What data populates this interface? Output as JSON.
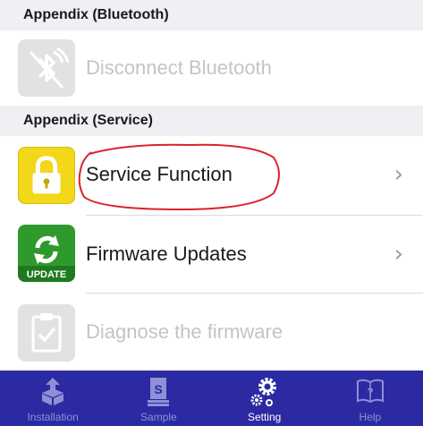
{
  "sections": {
    "bluetooth_header": "Appendix (Bluetooth)",
    "service_header": "Appendix (Service)"
  },
  "rows": {
    "disconnect_bluetooth": {
      "label": "Disconnect Bluetooth",
      "icon": "bluetooth-disabled-icon",
      "enabled": false
    },
    "service_function": {
      "label": "Service Function",
      "icon": "lock-icon",
      "enabled": true
    },
    "firmware_updates": {
      "label": "Firmware Updates",
      "icon": "update-icon",
      "icon_text": "UPDATE",
      "enabled": true
    },
    "diagnose_firmware": {
      "label": "Diagnose the firmware",
      "icon": "clipboard-check-icon",
      "enabled": false
    }
  },
  "tabbar": {
    "tabs": [
      {
        "label": "Installation",
        "icon": "installation-icon",
        "active": false
      },
      {
        "label": "Sample",
        "icon": "sample-document-icon",
        "active": false
      },
      {
        "label": "Setting",
        "icon": "gears-icon",
        "active": true
      },
      {
        "label": "Help",
        "icon": "help-book-icon",
        "active": false
      }
    ]
  },
  "colors": {
    "tabbar_bg": "#2b2aa3",
    "annotation_circle": "#d9232d",
    "lock_icon_bg": "#f2d71a",
    "update_icon_bg": "#2e9a2e"
  }
}
